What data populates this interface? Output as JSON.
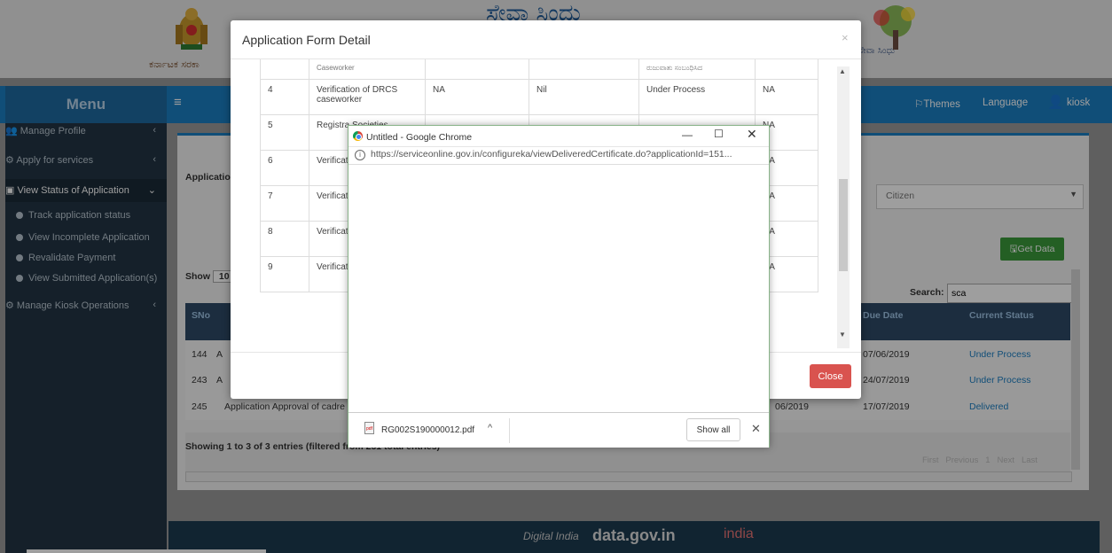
{
  "header": {
    "brand": "ಸೇವಾ ಸಿಂಧು",
    "emblem_caption": "ಕರ್ನಾಟಕ ಸರಕಾ"
  },
  "navbar": {
    "menu_title": "Menu",
    "themes": "Themes",
    "language": "Language",
    "user": "kiosk"
  },
  "sidebar": {
    "items": [
      {
        "label": "Manage Profile"
      },
      {
        "label": "Apply for services"
      },
      {
        "label": "View Status of Application"
      },
      {
        "label": "Manage Kiosk Operations"
      }
    ],
    "sub_items": [
      {
        "label": "Track application status"
      },
      {
        "label": "View Incomplete Application"
      },
      {
        "label": "Revalidate Payment"
      },
      {
        "label": "View Submitted Application(s)"
      }
    ]
  },
  "main": {
    "application_label": "Applicatio",
    "citizen_select": "Citizen",
    "get_data": "Get Data",
    "show_label": "Show",
    "show_value": "10",
    "search_label": "Search:",
    "search_value": "sca",
    "col_sno": "SNo",
    "col_due_date": "Due Date",
    "col_current_status": "Current Status",
    "rows": [
      {
        "sno": "144",
        "prefix": "A",
        "due": "07/06/2019",
        "status": "Under Process"
      },
      {
        "sno": "243",
        "prefix": "A",
        "due": "24/07/2019",
        "status": "Under Process"
      },
      {
        "sno": "245",
        "prefix": "Application Approval of cadre",
        "date_mid": "06/2019",
        "due": "17/07/2019",
        "status": "Delivered"
      }
    ],
    "showing_text": "Showing 1 to 3 of 3 entries (filtered from 251 total entries)",
    "pager": [
      "First",
      "Previous",
      "1",
      "Next",
      "Last"
    ]
  },
  "modal": {
    "title": "Application Form Detail",
    "close_label": "Close",
    "first_row_partial": [
      "Caseworker",
      "",
      "",
      "ರುಜುವಾತು ಸಂಬಂಧಿಸಿದ",
      ""
    ],
    "rows": [
      {
        "no": "4",
        "desc": "Verification of DRCS caseworker",
        "c3": "NA",
        "c4": "Nil",
        "c5": "Under Process",
        "c6": "NA"
      },
      {
        "no": "5",
        "desc": "Registra Societies",
        "c6": "NA"
      },
      {
        "no": "6",
        "desc": "Verification RCS Ca",
        "c6": "NA"
      },
      {
        "no": "7",
        "desc": "Verificati Superint",
        "c6": "NA"
      },
      {
        "no": "8",
        "desc": "Verificati Superinc",
        "c6": "NA"
      },
      {
        "no": "9",
        "desc": "Verificati",
        "c6": "NA"
      }
    ]
  },
  "chrome_popup": {
    "title": "Untitled - Google Chrome",
    "url": "https://serviceonline.gov.in/configureka/viewDeliveredCertificate.do?applicationId=151...",
    "download_file": "RG002S190000012.pdf",
    "show_all": "Show all"
  },
  "footer": {
    "logos": [
      "Digital India",
      "data.gov.in",
      "india"
    ]
  }
}
